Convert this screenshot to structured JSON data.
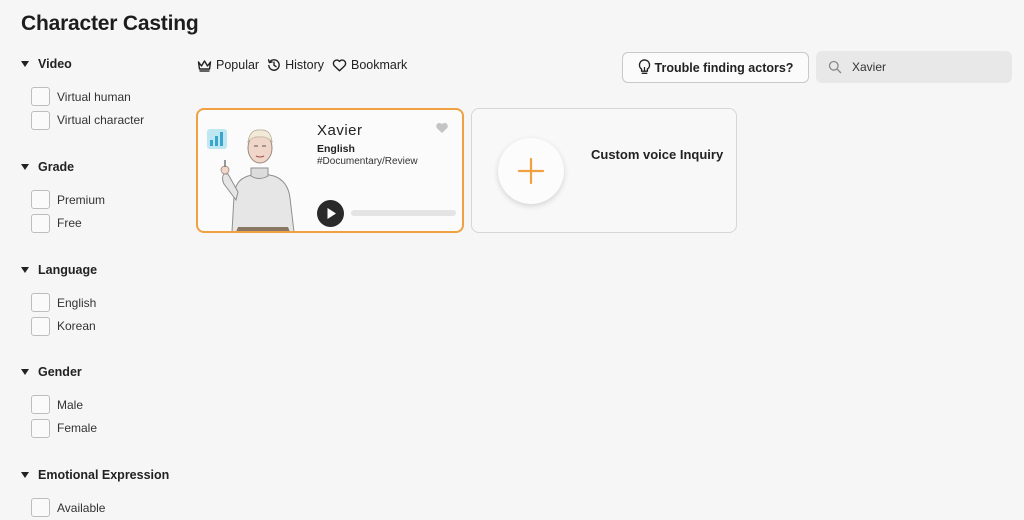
{
  "header": {
    "title": "Character Casting"
  },
  "filters": [
    {
      "title": "Video",
      "options": [
        "Virtual human",
        "Virtual character"
      ]
    },
    {
      "title": "Grade",
      "options": [
        "Premium",
        "Free"
      ]
    },
    {
      "title": "Language",
      "options": [
        "English",
        "Korean"
      ]
    },
    {
      "title": "Gender",
      "options": [
        "Male",
        "Female"
      ]
    },
    {
      "title": "Emotional Expression",
      "options": [
        "Available"
      ]
    }
  ],
  "tabs": [
    {
      "label": "Popular",
      "icon": "crown-icon"
    },
    {
      "label": "History",
      "icon": "history-icon"
    },
    {
      "label": "Bookmark",
      "icon": "heart-icon"
    }
  ],
  "toolbar": {
    "trouble_label": "Trouble finding actors?"
  },
  "search": {
    "value": "Xavier",
    "placeholder": ""
  },
  "actor": {
    "name": "Xavier",
    "language": "English",
    "tags": "#Documentary/Review",
    "progress": 0,
    "accent": "#f0a141"
  },
  "custom": {
    "label": "Custom voice Inquiry"
  }
}
